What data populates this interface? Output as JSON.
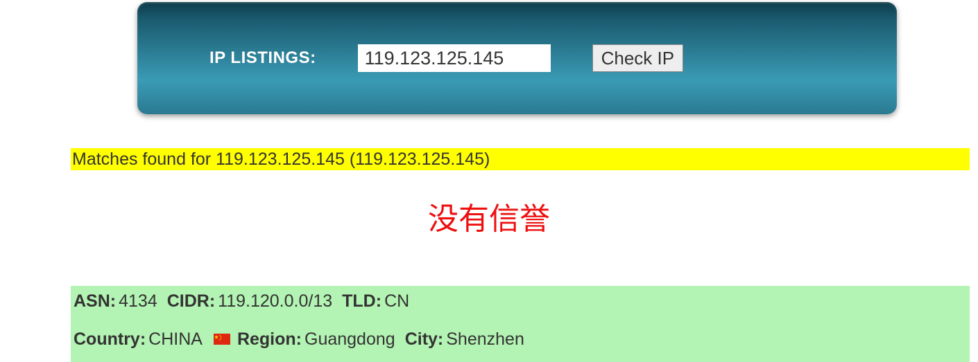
{
  "search": {
    "label": "IP LISTINGS:",
    "ip_value": "119.123.125.145",
    "button_label": "Check IP"
  },
  "matches": {
    "text": "Matches found for 119.123.125.145 (119.123.125.145)"
  },
  "reputation": {
    "status": "没有信誉"
  },
  "details": {
    "asn_label": "ASN:",
    "asn_value": "4134",
    "cidr_label": "CIDR:",
    "cidr_value": "119.120.0.0/13",
    "tld_label": "TLD:",
    "tld_value": "CN",
    "country_label": "Country:",
    "country_value": "CHINA",
    "region_label": "Region:",
    "region_value": "Guangdong",
    "city_label": "City:",
    "city_value": "Shenzhen"
  }
}
